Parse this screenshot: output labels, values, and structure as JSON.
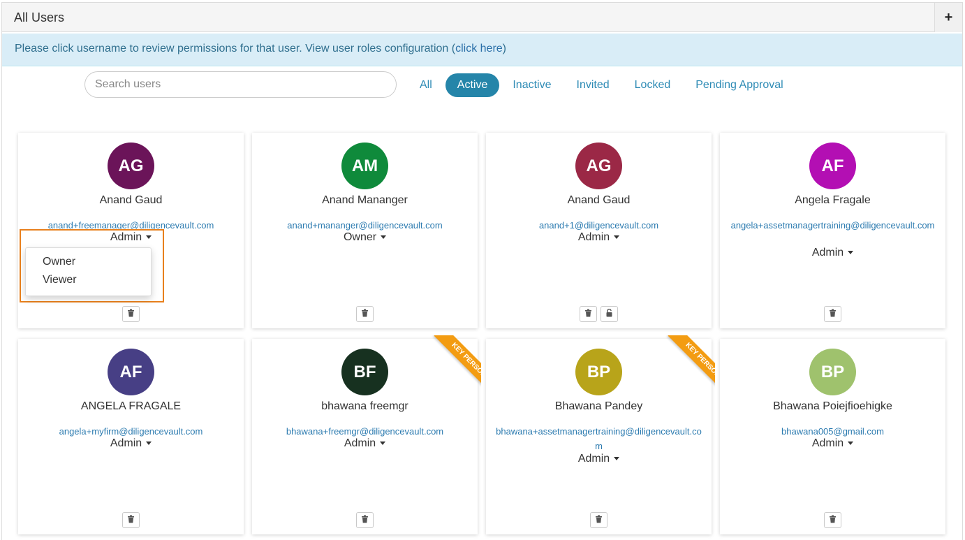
{
  "header": {
    "title": "All Users",
    "add_label": "+"
  },
  "info": {
    "text": "Please click username to review permissions for that user. View user roles configuration (",
    "link": "click here",
    "suffix": ")"
  },
  "search": {
    "placeholder": "Search users"
  },
  "filters": [
    "All",
    "Active",
    "Inactive",
    "Invited",
    "Locked",
    "Pending Approval"
  ],
  "active_filter": "Active",
  "users": [
    {
      "initials": "AG",
      "name": "Anand Gaud",
      "email": "anand+freemanager@diligencevault.com",
      "role": "Admin",
      "color": "#6b1459",
      "key_person": false,
      "locked": false
    },
    {
      "initials": "AM",
      "name": "Anand Mananger",
      "email": "anand+mananger@diligencevault.com",
      "role": "Owner",
      "color": "#0f8a3b",
      "key_person": false,
      "locked": false
    },
    {
      "initials": "AG",
      "name": "Anand Gaud",
      "email": "anand+1@diligencevault.com",
      "role": "Admin",
      "color": "#9b2846",
      "key_person": false,
      "locked": true
    },
    {
      "initials": "AF",
      "name": "Angela Fragale",
      "email": "angela+assetmanagertraining@diligencevault.com",
      "role": "Admin",
      "color": "#b30fb3",
      "key_person": false,
      "locked": false
    },
    {
      "initials": "AF",
      "name": "ANGELA FRAGALE",
      "email": "angela+myfirm@diligencevault.com",
      "role": "Admin",
      "color": "#473f85",
      "key_person": false,
      "locked": false
    },
    {
      "initials": "BF",
      "name": "bhawana freemgr",
      "email": "bhawana+freemgr@diligencevault.com",
      "role": "Admin",
      "color": "#173120",
      "key_person": true,
      "locked": false
    },
    {
      "initials": "BP",
      "name": "Bhawana Pandey",
      "email": "bhawana+assetmanagertraining@diligencevault.com",
      "role": "Admin",
      "color": "#b8a41a",
      "key_person": true,
      "locked": false
    },
    {
      "initials": "BP",
      "name": "Bhawana Poiejfioehigke",
      "email": "bhawana005@gmail.com",
      "role": "Admin",
      "color": "#9fc26d",
      "key_person": false,
      "locked": false
    }
  ],
  "ribbon_label": "KEY PERSON",
  "role_dropdown": {
    "options": [
      "Owner",
      "Viewer"
    ]
  }
}
